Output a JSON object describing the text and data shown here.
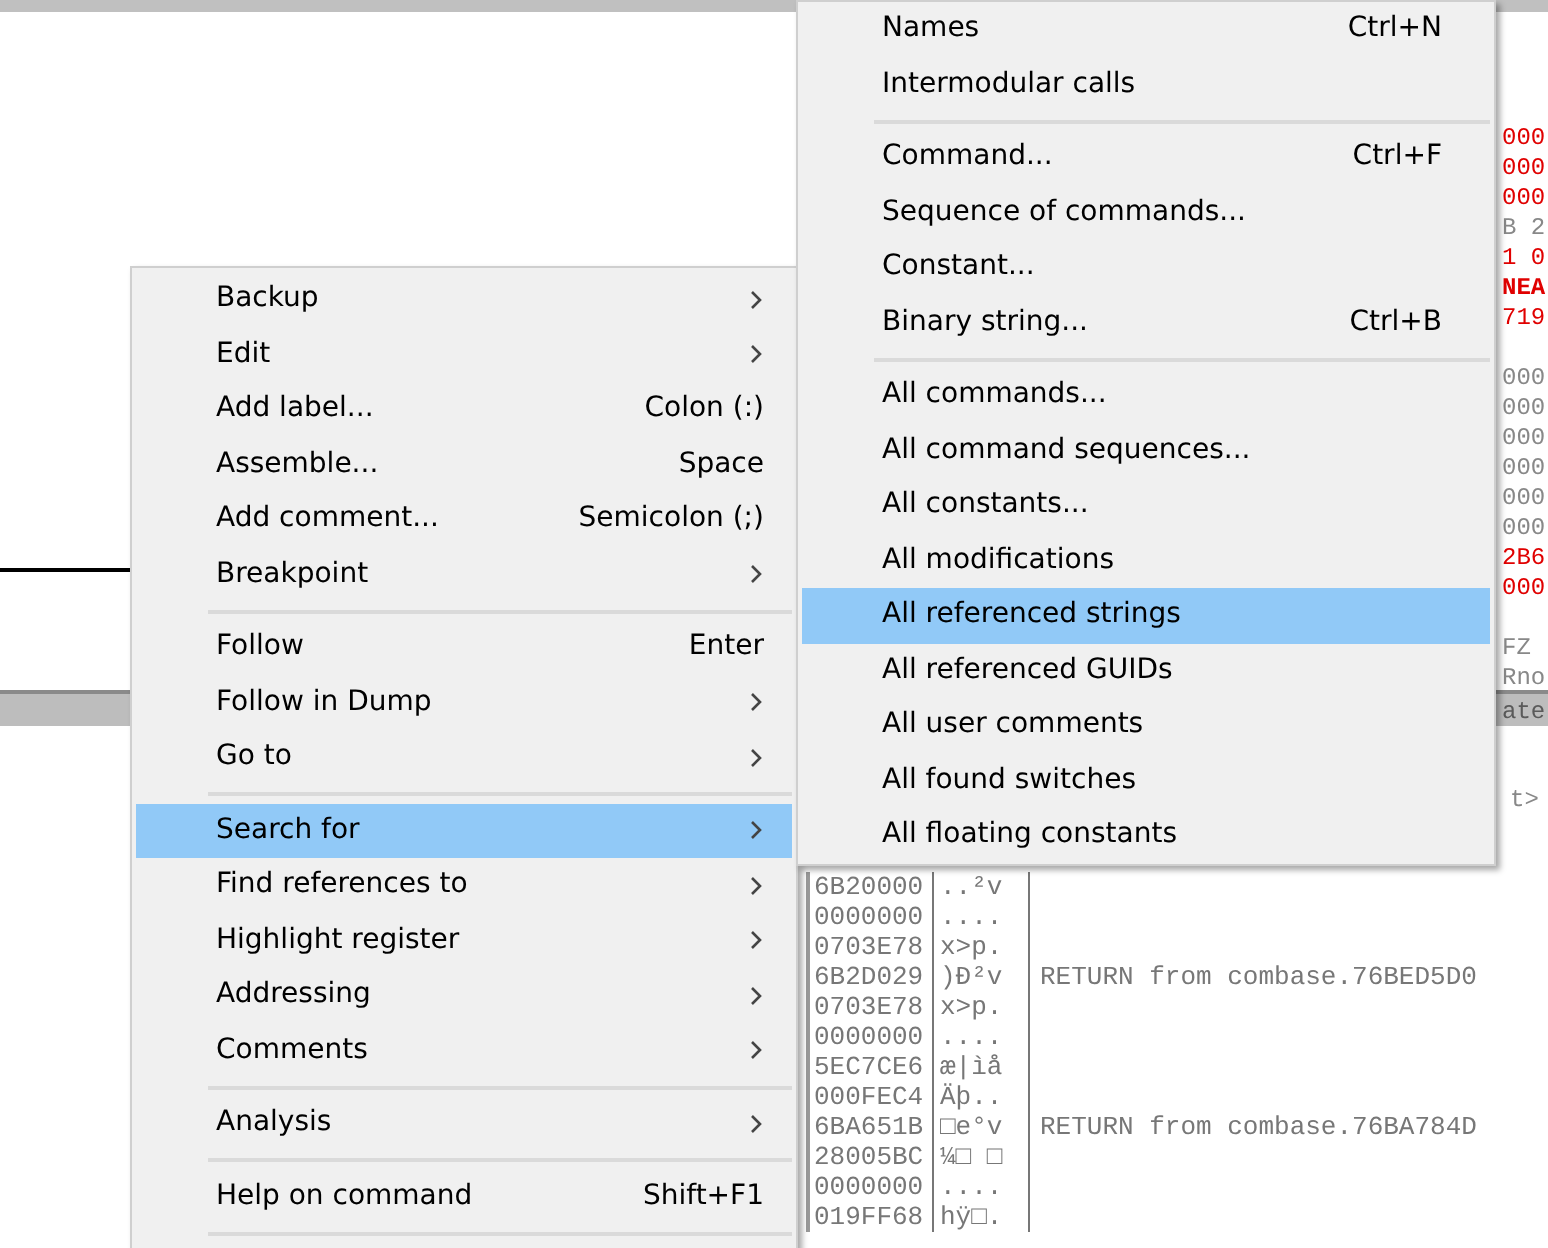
{
  "side_fragments": [
    {
      "text": "000",
      "kind": "red"
    },
    {
      "text": "000",
      "kind": "red"
    },
    {
      "text": "000",
      "kind": "red"
    },
    {
      "text": "B 2",
      "kind": "grey"
    },
    {
      "text": "1 0",
      "kind": "red"
    },
    {
      "text": "NEA",
      "kind": "redbold"
    },
    {
      "text": "719",
      "kind": "red"
    },
    {
      "kind": "spacer"
    },
    {
      "text": "000",
      "kind": "grey"
    },
    {
      "text": "000",
      "kind": "grey"
    },
    {
      "text": "000",
      "kind": "grey"
    },
    {
      "text": "000",
      "kind": "grey"
    },
    {
      "text": "000",
      "kind": "grey"
    },
    {
      "text": "000",
      "kind": "grey"
    },
    {
      "text": "2B6",
      "kind": "red"
    },
    {
      "text": "000",
      "kind": "red"
    },
    {
      "kind": "spacer"
    },
    {
      "text": "FZ",
      "kind": "grey"
    },
    {
      "text": "Rno",
      "kind": "grey"
    }
  ],
  "splitter_fragment": "ate",
  "pane_fragment": "t>",
  "dump_rows": [
    {
      "address": "6B20000",
      "ascii": "..²v"
    },
    {
      "address": "0000000",
      "ascii": "...."
    },
    {
      "address": "0703E78",
      "ascii": "x>p."
    },
    {
      "address": "6B2D029",
      "ascii": ")Ð²v",
      "comment": "RETURN from combase.76BED5D0"
    },
    {
      "address": "0703E78",
      "ascii": "x>p."
    },
    {
      "address": "0000000",
      "ascii": "...."
    },
    {
      "address": "5EC7CE6",
      "ascii": "æ|ìå"
    },
    {
      "address": "000FEC4",
      "ascii": "Äþ.."
    },
    {
      "address": "6BA651B",
      "ascii": "□e°v",
      "comment": "RETURN from combase.76BA784D"
    },
    {
      "address": "28005BC",
      "ascii": "¼□ □"
    },
    {
      "address": "0000000",
      "ascii": "...."
    },
    {
      "address": "019FF68",
      "ascii": "hÿ□."
    }
  ],
  "context_menu": {
    "items": [
      {
        "kind": "item",
        "label": "Backup",
        "submenu": true,
        "selected": false
      },
      {
        "kind": "item",
        "label": "Edit",
        "submenu": true,
        "selected": false
      },
      {
        "kind": "item",
        "label": "Add label...",
        "shortcut": "Colon (:)",
        "submenu": false,
        "selected": false
      },
      {
        "kind": "item",
        "label": "Assemble...",
        "shortcut": "Space",
        "submenu": false,
        "selected": false
      },
      {
        "kind": "item",
        "label": "Add comment...",
        "shortcut": "Semicolon (;)",
        "submenu": false,
        "selected": false
      },
      {
        "kind": "item",
        "label": "Breakpoint",
        "submenu": true,
        "selected": false
      },
      {
        "kind": "separator"
      },
      {
        "kind": "item",
        "label": "Follow",
        "shortcut": "Enter",
        "submenu": false,
        "selected": false
      },
      {
        "kind": "item",
        "label": "Follow in Dump",
        "submenu": true,
        "selected": false
      },
      {
        "kind": "item",
        "label": "Go to",
        "submenu": true,
        "selected": false
      },
      {
        "kind": "separator"
      },
      {
        "kind": "item",
        "label": "Search for",
        "submenu": true,
        "selected": true
      },
      {
        "kind": "item",
        "label": "Find references to",
        "submenu": true,
        "selected": false
      },
      {
        "kind": "item",
        "label": "Highlight register",
        "submenu": true,
        "selected": false
      },
      {
        "kind": "item",
        "label": "Addressing",
        "submenu": true,
        "selected": false
      },
      {
        "kind": "item",
        "label": "Comments",
        "submenu": true,
        "selected": false
      },
      {
        "kind": "separator"
      },
      {
        "kind": "item",
        "label": "Analysis",
        "submenu": true,
        "selected": false
      },
      {
        "kind": "separator"
      },
      {
        "kind": "item",
        "label": "Help on command",
        "shortcut": "Shift+F1",
        "submenu": false,
        "selected": false
      },
      {
        "kind": "separator"
      }
    ]
  },
  "search_submenu": {
    "items": [
      {
        "kind": "item",
        "label": "Names",
        "shortcut": "Ctrl+N",
        "selected": false
      },
      {
        "kind": "item",
        "label": "Intermodular calls",
        "selected": false
      },
      {
        "kind": "separator"
      },
      {
        "kind": "item",
        "label": "Command...",
        "shortcut": "Ctrl+F",
        "selected": false
      },
      {
        "kind": "item",
        "label": "Sequence of commands...",
        "selected": false
      },
      {
        "kind": "item",
        "label": "Constant...",
        "selected": false
      },
      {
        "kind": "item",
        "label": "Binary string...",
        "shortcut": "Ctrl+B",
        "selected": false
      },
      {
        "kind": "separator"
      },
      {
        "kind": "item",
        "label": "All commands...",
        "selected": false
      },
      {
        "kind": "item",
        "label": "All command sequences...",
        "selected": false
      },
      {
        "kind": "item",
        "label": "All constants...",
        "selected": false
      },
      {
        "kind": "item",
        "label": "All modifications",
        "selected": false
      },
      {
        "kind": "item",
        "label": "All referenced strings",
        "selected": true
      },
      {
        "kind": "item",
        "label": "All referenced GUIDs",
        "selected": false
      },
      {
        "kind": "item",
        "label": "All user comments",
        "selected": false
      },
      {
        "kind": "item",
        "label": "All found switches",
        "selected": false
      },
      {
        "kind": "item",
        "label": "All floating constants",
        "selected": false
      }
    ]
  }
}
